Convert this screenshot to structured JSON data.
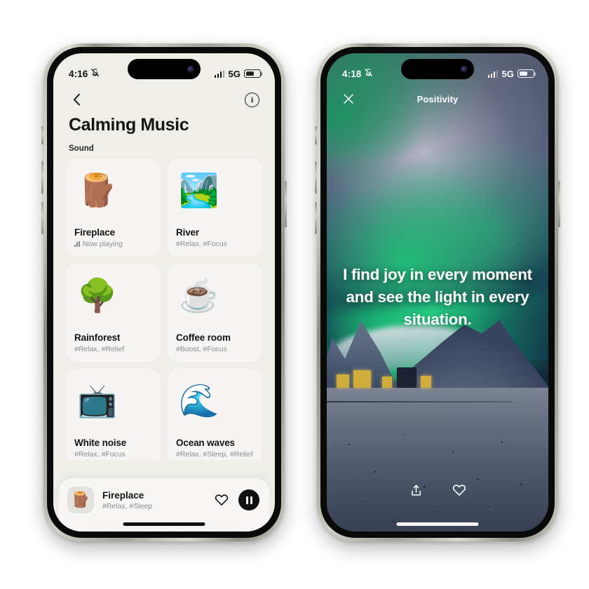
{
  "left_phone": {
    "status_bar": {
      "time": "4:16",
      "silent_icon": "bell-slash-icon",
      "network": "5G",
      "signal_icon": "signal-bars-icon",
      "battery_icon": "battery-icon"
    },
    "nav": {
      "back_label": "back-chevron",
      "info_label": "i"
    },
    "page_title": "Calming Music",
    "section_label": "Sound",
    "cards": [
      {
        "emoji": "🪵",
        "title": "Fireplace",
        "subtitle": "Now playing",
        "now_playing": true
      },
      {
        "emoji": "🏞️",
        "title": "River",
        "subtitle": "#Relax, #Focus",
        "now_playing": false
      },
      {
        "emoji": "🌳",
        "title": "Rainforest",
        "subtitle": "#Relax, #Relief",
        "now_playing": false
      },
      {
        "emoji": "☕",
        "title": "Coffee room",
        "subtitle": "#Boost, #Focus",
        "now_playing": false
      },
      {
        "emoji": "📺",
        "title": "White noise",
        "subtitle": "#Relax, #Focus",
        "now_playing": false
      },
      {
        "emoji": "🌊",
        "title": "Ocean waves",
        "subtitle": "#Relax, #Sleep, #Relief",
        "now_playing": false
      }
    ],
    "mini_player": {
      "thumb_emoji": "🪵",
      "title": "Fireplace",
      "subtitle": "#Relax, #Sleep",
      "heart_icon": "heart-icon",
      "transport_icon": "pause-icon"
    }
  },
  "right_phone": {
    "status_bar": {
      "time": "4:18",
      "silent_icon": "bell-slash-icon",
      "network": "5G",
      "signal_icon": "signal-bars-icon",
      "battery_icon": "battery-icon"
    },
    "nav": {
      "title": "Positivity",
      "close_icon": "close-icon"
    },
    "quote": "I find joy in every moment and see the light in every situation.",
    "actions": {
      "share_icon": "share-icon",
      "heart_icon": "heart-icon"
    }
  },
  "colors": {
    "page_background": "#ffffff",
    "app_light_bg": "#efeee9",
    "card_bg": "#f6f5f3",
    "text_primary": "#141414",
    "text_muted": "#8c8c8c",
    "accent_dark": "#111111",
    "aurora_green": "#1ec878",
    "photo_text": "#ffffff"
  }
}
